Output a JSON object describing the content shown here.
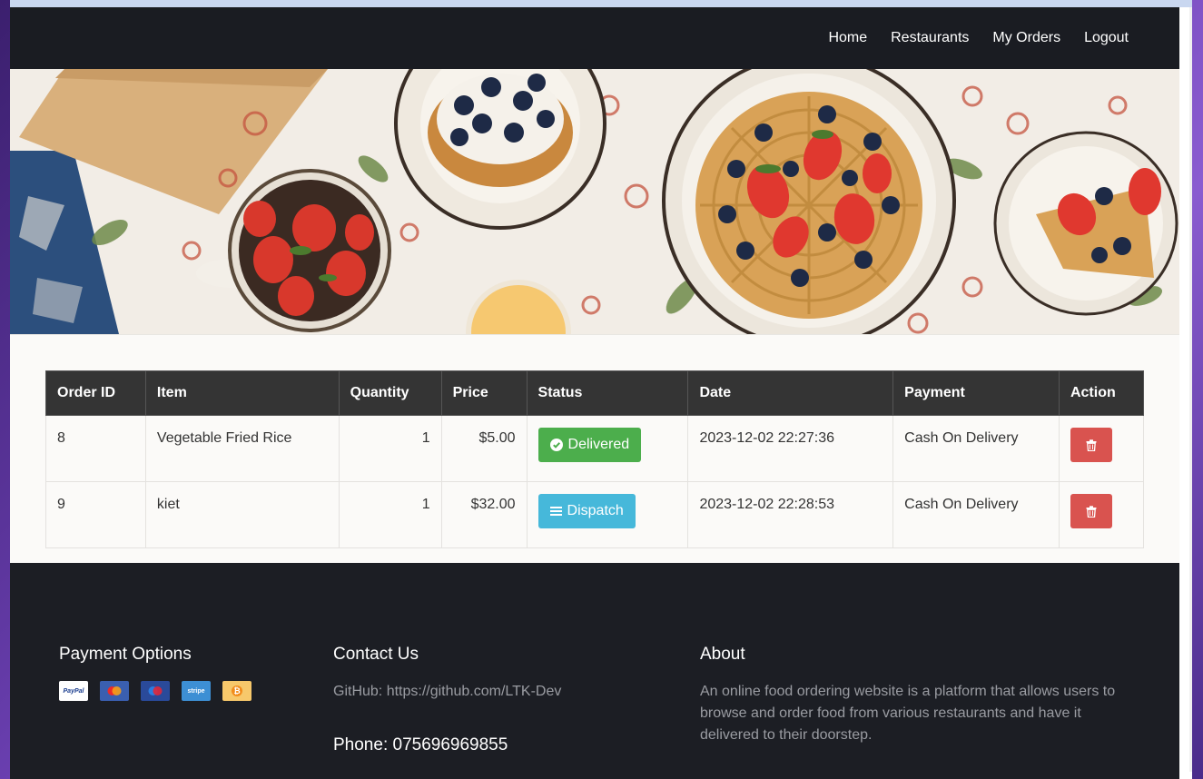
{
  "nav": {
    "items": [
      {
        "label": "Home"
      },
      {
        "label": "Restaurants"
      },
      {
        "label": "My Orders"
      },
      {
        "label": "Logout"
      }
    ]
  },
  "orders": {
    "headers": [
      "Order ID",
      "Item",
      "Quantity",
      "Price",
      "Status",
      "Date",
      "Payment",
      "Action"
    ],
    "rows": [
      {
        "id": "8",
        "item": "Vegetable Fried Rice",
        "quantity": "1",
        "price": "$5.00",
        "status": "Delivered",
        "status_icon": "check-circle-icon",
        "status_color": "#4cae4c",
        "date": "2023-12-02 22:27:36",
        "payment": "Cash On Delivery"
      },
      {
        "id": "9",
        "item": "kiet",
        "quantity": "1",
        "price": "$32.00",
        "status": "Dispatch",
        "status_icon": "bars-icon",
        "status_color": "#46b8da",
        "date": "2023-12-02 22:28:53",
        "payment": "Cash On Delivery"
      }
    ]
  },
  "footer": {
    "payment_title": "Payment Options",
    "payment_icons": [
      "paypal-icon",
      "mastercard-icon",
      "maestro-icon",
      "stripe-icon",
      "bitcoin-icon"
    ],
    "contact_title": "Contact Us",
    "github": "GitHub: https://github.com/LTK-Dev",
    "phone": "Phone: 075696969855",
    "about_title": "About",
    "about_text": "An online food ordering website is a platform that allows users to browse and order food from various restaurants and have it delivered to their doorstep."
  },
  "colors": {
    "nav_bg": "#1a1c22",
    "delete": "#d9534f"
  }
}
